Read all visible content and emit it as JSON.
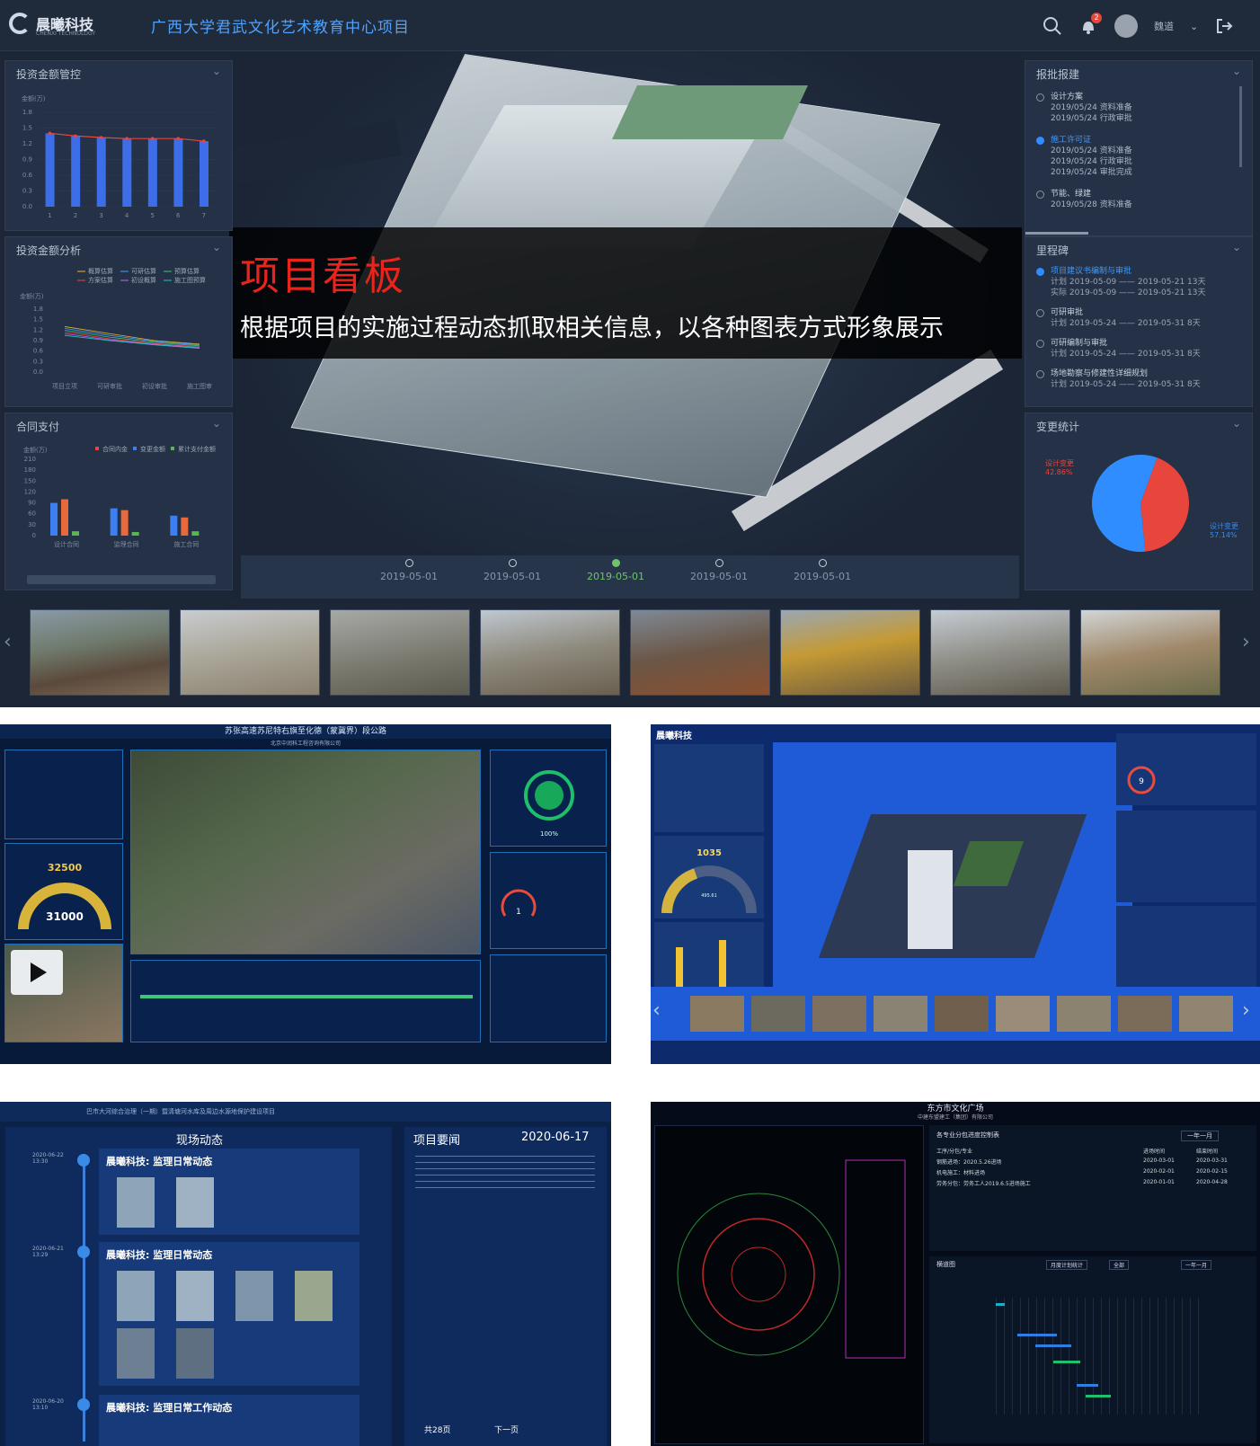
{
  "main": {
    "brand": {
      "name": "晨曦科技",
      "subtitle": "CHENXI TECHNOLOGY"
    },
    "project_title": "广西大学君武文化艺术教育中心项目",
    "user": {
      "name": "魏道",
      "notification_count": "2"
    },
    "banner": {
      "title": "项目看板",
      "subtitle": "根据项目的实施过程动态抓取相关信息，以各种图表方式形象展示"
    },
    "left_panels": [
      {
        "title": "投资金额管控",
        "unit": "金额(万)"
      },
      {
        "title": "投资金额分析",
        "unit": "金额(万)",
        "legend": [
          "概算估算",
          "可研估算",
          "预算估算",
          "方案估算",
          "初设概算",
          "施工图预算"
        ],
        "x_labels": [
          "项目立项",
          "可研审批",
          "初设审批",
          "施工图审"
        ]
      },
      {
        "title": "合同支付",
        "unit": "金额(万)",
        "legend": [
          "合同内金",
          "变更金额",
          "累计支付金额"
        ],
        "x_labels": [
          "设计合同",
          "监理合同",
          "施工合同"
        ]
      }
    ],
    "right_panels": {
      "approval": {
        "title": "报批报建",
        "items": [
          {
            "title": "设计方案",
            "active": false,
            "lines": [
              "2019/05/24 资料准备",
              "2019/05/24 行政审批"
            ]
          },
          {
            "title": "施工许可证",
            "active": true,
            "lines": [
              "2019/05/24 资料准备",
              "2019/05/24 行政审批",
              "2019/05/24 审批完成"
            ]
          },
          {
            "title": "节能、绿建",
            "active": false,
            "lines": [
              "2019/05/28 资料准备"
            ]
          }
        ]
      },
      "milestones": {
        "title": "里程碑",
        "items": [
          {
            "title": "项目建议书编制与审批",
            "active": true,
            "rows": [
              "计划  2019-05-09 —— 2019-05-21  13天",
              "实际  2019-05-09 —— 2019-05-21  13天"
            ]
          },
          {
            "title": "可研审批",
            "active": false,
            "rows": [
              "计划  2019-05-24 —— 2019-05-31  8天"
            ]
          },
          {
            "title": "可研编制与审批",
            "active": false,
            "rows": [
              "计划  2019-05-24 —— 2019-05-31  8天"
            ]
          },
          {
            "title": "场地勘察与修建性详细规划",
            "active": false,
            "rows": [
              "计划  2019-05-24 —— 2019-05-31  8天"
            ]
          }
        ]
      },
      "changes": {
        "title": "变更统计",
        "label_a": "设计变更",
        "value_a": "42.86%",
        "label_b": "设计变更",
        "value_b": "57.14%"
      }
    },
    "timeline": [
      {
        "label": "2019-05-01",
        "active": false
      },
      {
        "label": "2019-05-01",
        "active": false
      },
      {
        "label": "2019-05-01",
        "active": true
      },
      {
        "label": "2019-05-01",
        "active": false
      },
      {
        "label": "2019-05-01",
        "active": false
      }
    ]
  },
  "chart_data": [
    {
      "type": "bar",
      "title": "投资金额管控",
      "ylabel": "金额(万)",
      "ylim": [
        0,
        1.8
      ],
      "categories": [
        "1",
        "2",
        "3",
        "4",
        "5",
        "6",
        "7"
      ],
      "values": [
        1.4,
        1.35,
        1.32,
        1.3,
        1.3,
        1.3,
        1.25
      ]
    },
    {
      "type": "line",
      "title": "投资金额分析",
      "ylabel": "金额(万)",
      "ylim": [
        0,
        1.8
      ],
      "categories": [
        "项目立项",
        "可研审批",
        "初设审批",
        "施工图审"
      ],
      "series": [
        {
          "name": "概算估算",
          "values": [
            1.3,
            1.1,
            0.9,
            0.8
          ]
        },
        {
          "name": "可研估算",
          "values": [
            1.25,
            1.05,
            0.88,
            0.78
          ]
        },
        {
          "name": "预算估算",
          "values": [
            1.2,
            1.0,
            0.85,
            0.75
          ]
        },
        {
          "name": "方案估算",
          "values": [
            1.15,
            0.95,
            0.82,
            0.72
          ]
        },
        {
          "name": "初设概算",
          "values": [
            1.1,
            0.92,
            0.8,
            0.7
          ]
        },
        {
          "name": "施工图预算",
          "values": [
            1.05,
            0.9,
            0.78,
            0.68
          ]
        }
      ]
    },
    {
      "type": "bar",
      "title": "合同支付",
      "ylabel": "金额(万)",
      "ylim": [
        0,
        210
      ],
      "categories": [
        "设计合同",
        "监理合同",
        "施工合同"
      ],
      "series": [
        {
          "name": "合同内金",
          "values": [
            90,
            75,
            55
          ]
        },
        {
          "name": "变更金额",
          "values": [
            100,
            70,
            50
          ]
        },
        {
          "name": "累计支付金额",
          "values": [
            12,
            10,
            12
          ]
        }
      ]
    },
    {
      "type": "pie",
      "title": "变更统计",
      "slices": [
        {
          "label": "设计变更",
          "value": 42.86
        },
        {
          "label": "设计变更",
          "value": 57.14
        }
      ]
    }
  ],
  "shot1": {
    "title": "苏张高速苏尼特右旗至化德（蒙冀界）段公路",
    "subtitle": "北京中润科工程咨询有限公司",
    "gauge_top": "32500",
    "gauge_bottom": "31000",
    "progress_pct": "100%",
    "safety_count": "1"
  },
  "shot2": {
    "brand": "晨曦科技",
    "gauge_value": "1035",
    "gauge_sub": "495.61",
    "risk_count": "9"
  },
  "shot3": {
    "header": "巴市大河综合治理（一期）暨清塘河水库及周边水源地保护建设项目",
    "live_title": "现场动态",
    "news_title": "项目要闻",
    "news_date": "2020-06-17",
    "entry": "晨曦科技: 监理日常动态",
    "entry3": "晨曦科技: 监理日常工作动态",
    "time1": "2020-06-22 13:30",
    "time2": "2020-06-21 13:29",
    "time3": "2020-06-20 13:10",
    "pager_total": "共28页",
    "pager_next": "下一页"
  },
  "shot4": {
    "title": "东方市文化广场",
    "subtitle": "中建东盟建工（集团）有限公司",
    "table_title": "各专业分包进度控制表",
    "period": "一年一月",
    "rows": [
      [
        "工序/分包/专业",
        "进场时间",
        "结束时间"
      ],
      [
        "钢筋进场：2020.5.26进场",
        "2020-03-01",
        "2020-03-31"
      ],
      [
        "机电施工：材料进场",
        "2020-02-01",
        "2020-02-15"
      ],
      [
        "劳务分包：劳务工人2019.6.5进场施工",
        "2020-01-01",
        "2020-04-28"
      ]
    ],
    "gantt_title": "横道图",
    "gantt_filter": "月度计划统计",
    "gantt_all": "全部"
  }
}
